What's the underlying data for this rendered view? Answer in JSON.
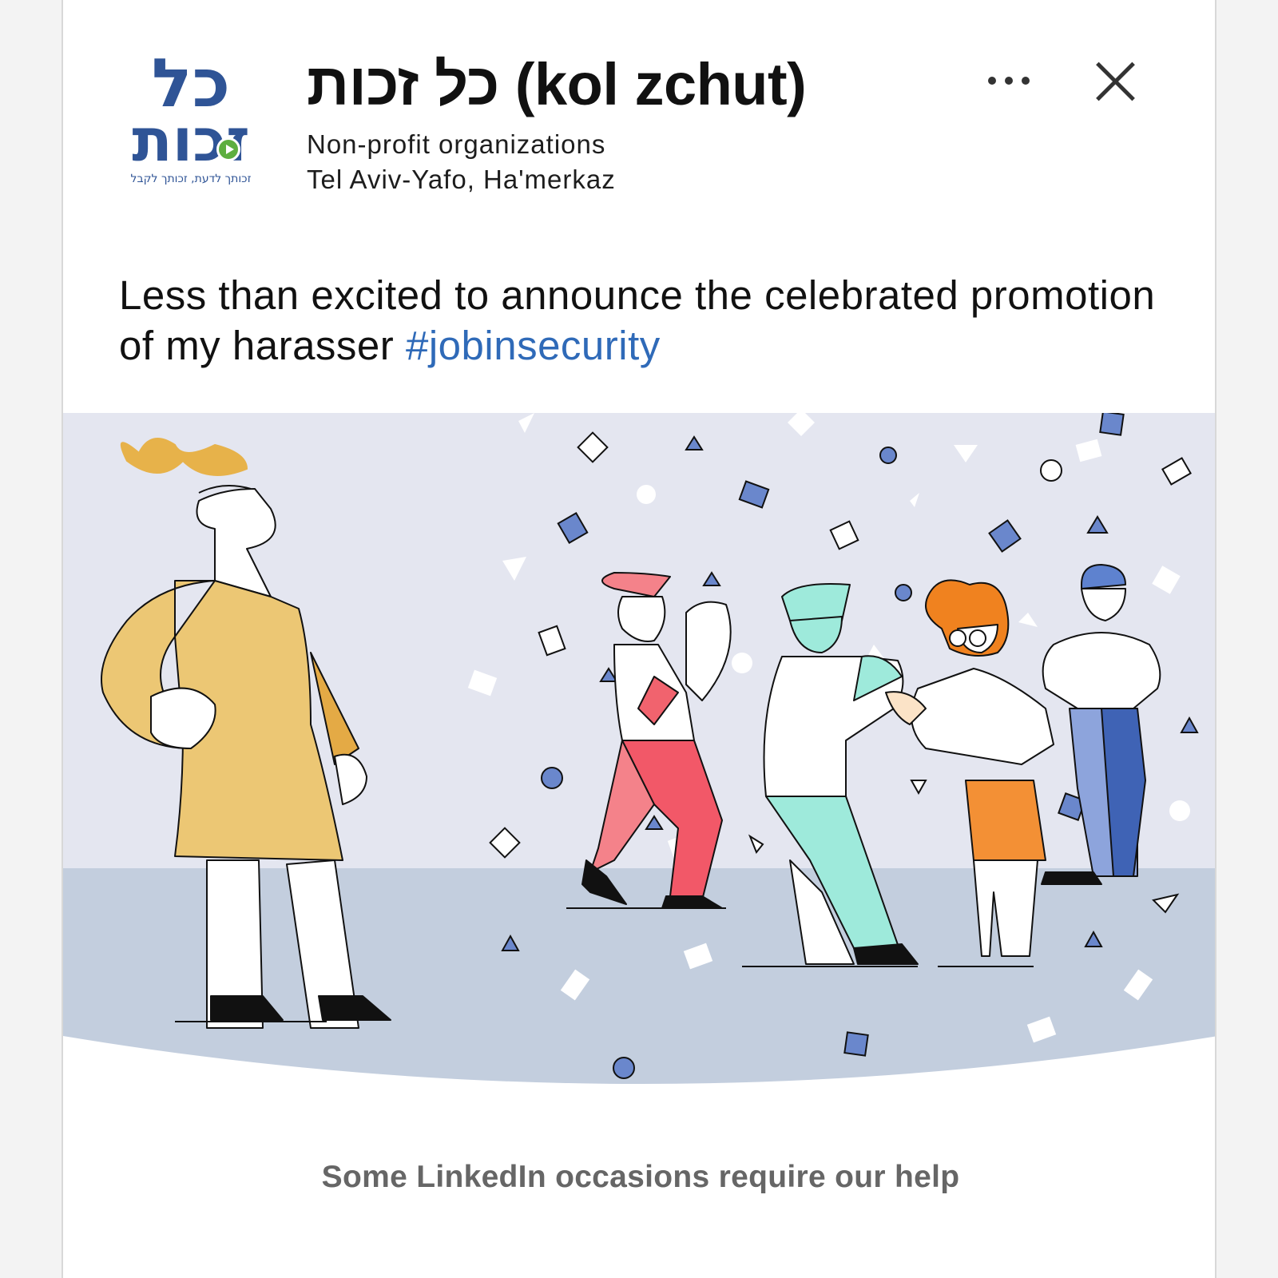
{
  "header": {
    "logo": {
      "alt_name": "kol-zchut-logo",
      "word_top": "כל",
      "word_bottom": "זכות",
      "tagline": "זכותך לדעת, זכותך לקבל",
      "brand_color": "#2f5496",
      "accent_color": "#5dae3f"
    },
    "org_name": "כל זכות (kol zchut)",
    "category": "Non-profit organizations",
    "location": "Tel Aviv-Yafo, Ha'merkaz",
    "more_icon": "ellipsis-icon",
    "close_icon": "close-icon"
  },
  "post": {
    "text": "Less than excited to announce the celebrated promotion of my harasser ",
    "hashtag": "#jobinsecurity",
    "hashtag_color": "#2f6ab8"
  },
  "illustration": {
    "description_icon": "celebration-illustration",
    "background_color": "#e4e6f0",
    "floor_color": "#c3cede",
    "confetti_color": "#6a87cc"
  },
  "footer": {
    "cta": "Some LinkedIn occasions require our help"
  }
}
